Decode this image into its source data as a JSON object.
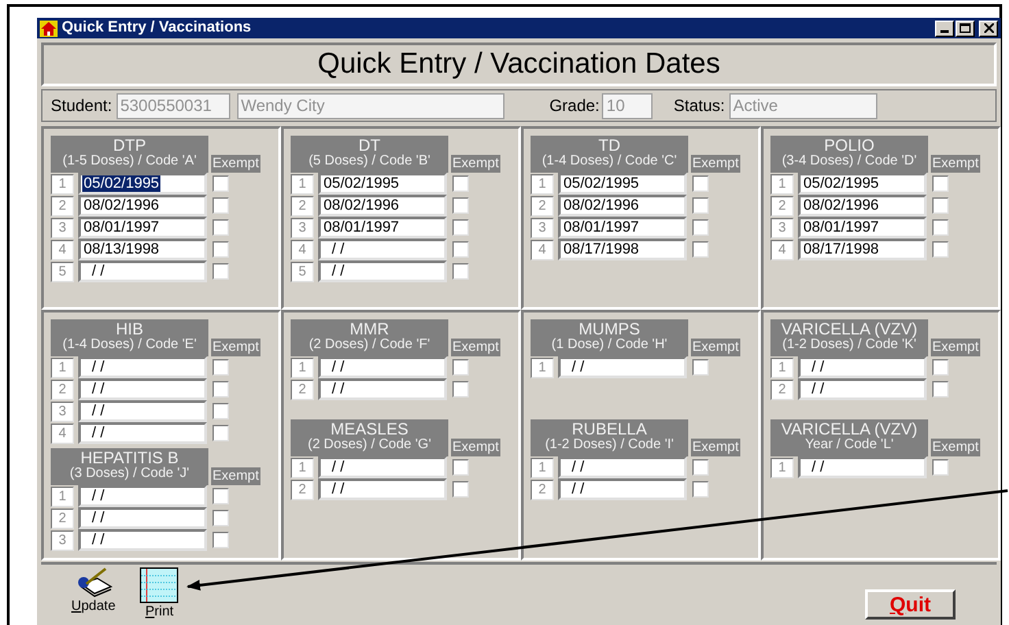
{
  "window": {
    "title": "Quick Entry / Vaccinations"
  },
  "header": {
    "title": "Quick Entry / Vaccination Dates"
  },
  "student": {
    "label": "Student:",
    "id": "5300550031",
    "name": "Wendy City"
  },
  "grade": {
    "label": "Grade:",
    "value": "10"
  },
  "status": {
    "label": "Status:",
    "value": "Active"
  },
  "panels": [
    {
      "groups": [
        {
          "name": "DTP",
          "subtitle": "(1-5 Doses) / Code 'A'",
          "exempt_label": "Exempt",
          "doses": [
            {
              "number": "1",
              "date": "05/02/1995",
              "selected": true,
              "exempt": false
            },
            {
              "number": "2",
              "date": "08/02/1996",
              "selected": false,
              "exempt": false
            },
            {
              "number": "3",
              "date": "08/01/1997",
              "selected": false,
              "exempt": false
            },
            {
              "number": "4",
              "date": "08/13/1998",
              "selected": false,
              "exempt": false
            },
            {
              "number": "5",
              "date": "/ /",
              "selected": false,
              "exempt": false
            }
          ]
        }
      ]
    },
    {
      "groups": [
        {
          "name": "DT",
          "subtitle": "(5 Doses) / Code 'B'",
          "exempt_label": "Exempt",
          "doses": [
            {
              "number": "1",
              "date": "05/02/1995",
              "selected": false,
              "exempt": false
            },
            {
              "number": "2",
              "date": "08/02/1996",
              "selected": false,
              "exempt": false
            },
            {
              "number": "3",
              "date": "08/01/1997",
              "selected": false,
              "exempt": false
            },
            {
              "number": "4",
              "date": "/ /",
              "selected": false,
              "exempt": false
            },
            {
              "number": "5",
              "date": "/ /",
              "selected": false,
              "exempt": false
            }
          ]
        }
      ]
    },
    {
      "groups": [
        {
          "name": "TD",
          "subtitle": "(1-4 Doses) / Code 'C'",
          "exempt_label": "Exempt",
          "doses": [
            {
              "number": "1",
              "date": "05/02/1995",
              "selected": false,
              "exempt": false
            },
            {
              "number": "2",
              "date": "08/02/1996",
              "selected": false,
              "exempt": false
            },
            {
              "number": "3",
              "date": "08/01/1997",
              "selected": false,
              "exempt": false
            },
            {
              "number": "4",
              "date": "08/17/1998",
              "selected": false,
              "exempt": false
            }
          ]
        }
      ]
    },
    {
      "groups": [
        {
          "name": "POLIO",
          "subtitle": "(3-4 Doses) / Code 'D'",
          "exempt_label": "Exempt",
          "doses": [
            {
              "number": "1",
              "date": "05/02/1995",
              "selected": false,
              "exempt": false
            },
            {
              "number": "2",
              "date": "08/02/1996",
              "selected": false,
              "exempt": false
            },
            {
              "number": "3",
              "date": "08/01/1997",
              "selected": false,
              "exempt": false
            },
            {
              "number": "4",
              "date": "08/17/1998",
              "selected": false,
              "exempt": false
            }
          ]
        }
      ]
    },
    {
      "groups": [
        {
          "name": "HIB",
          "subtitle": "(1-4 Doses) / Code 'E'",
          "exempt_label": "Exempt",
          "doses": [
            {
              "number": "1",
              "date": "/ /",
              "selected": false,
              "exempt": false
            },
            {
              "number": "2",
              "date": "/ /",
              "selected": false,
              "exempt": false
            },
            {
              "number": "3",
              "date": "/ /",
              "selected": false,
              "exempt": false
            },
            {
              "number": "4",
              "date": "/ /",
              "selected": false,
              "exempt": false
            }
          ]
        },
        {
          "name": "HEPATITIS B",
          "subtitle": "(3 Doses) / Code 'J'",
          "exempt_label": "Exempt",
          "doses": [
            {
              "number": "1",
              "date": "/ /",
              "selected": false,
              "exempt": false
            },
            {
              "number": "2",
              "date": "/ /",
              "selected": false,
              "exempt": false
            },
            {
              "number": "3",
              "date": "/ /",
              "selected": false,
              "exempt": false
            }
          ]
        }
      ]
    },
    {
      "groups": [
        {
          "name": "MMR",
          "subtitle": "(2 Doses) / Code 'F'",
          "exempt_label": "Exempt",
          "doses": [
            {
              "number": "1",
              "date": "/ /",
              "selected": false,
              "exempt": false
            },
            {
              "number": "2",
              "date": "/ /",
              "selected": false,
              "exempt": false
            }
          ]
        },
        {
          "name": "MEASLES",
          "subtitle": "(2 Doses) / Code 'G'",
          "exempt_label": "Exempt",
          "doses": [
            {
              "number": "1",
              "date": "/ /",
              "selected": false,
              "exempt": false
            },
            {
              "number": "2",
              "date": "/ /",
              "selected": false,
              "exempt": false
            }
          ]
        }
      ]
    },
    {
      "groups": [
        {
          "name": "MUMPS",
          "subtitle": "(1 Dose) / Code 'H'",
          "exempt_label": "Exempt",
          "doses": [
            {
              "number": "1",
              "date": "/ /",
              "selected": false,
              "exempt": false
            }
          ]
        },
        {
          "name": "RUBELLA",
          "subtitle": "(1-2 Doses) / Code 'I'",
          "exempt_label": "Exempt",
          "doses": [
            {
              "number": "1",
              "date": "/ /",
              "selected": false,
              "exempt": false
            },
            {
              "number": "2",
              "date": "/ /",
              "selected": false,
              "exempt": false
            }
          ]
        }
      ]
    },
    {
      "groups": [
        {
          "name": "VARICELLA (VZV)",
          "subtitle": "(1-2 Doses) / Code 'K'",
          "exempt_label": "Exempt",
          "doses": [
            {
              "number": "1",
              "date": "/ /",
              "selected": false,
              "exempt": false
            },
            {
              "number": "2",
              "date": "/ /",
              "selected": false,
              "exempt": false
            }
          ]
        },
        {
          "name": "VARICELLA (VZV)",
          "subtitle": "Year / Code 'L'",
          "exempt_label": "Exempt",
          "doses": [
            {
              "number": "1",
              "date": "/ /",
              "selected": false,
              "exempt": false
            }
          ]
        }
      ]
    }
  ],
  "toolbar": [
    {
      "kind": "update",
      "label": "Update"
    },
    {
      "kind": "print",
      "label": "Print"
    }
  ],
  "quit": {
    "label": "Quit"
  }
}
